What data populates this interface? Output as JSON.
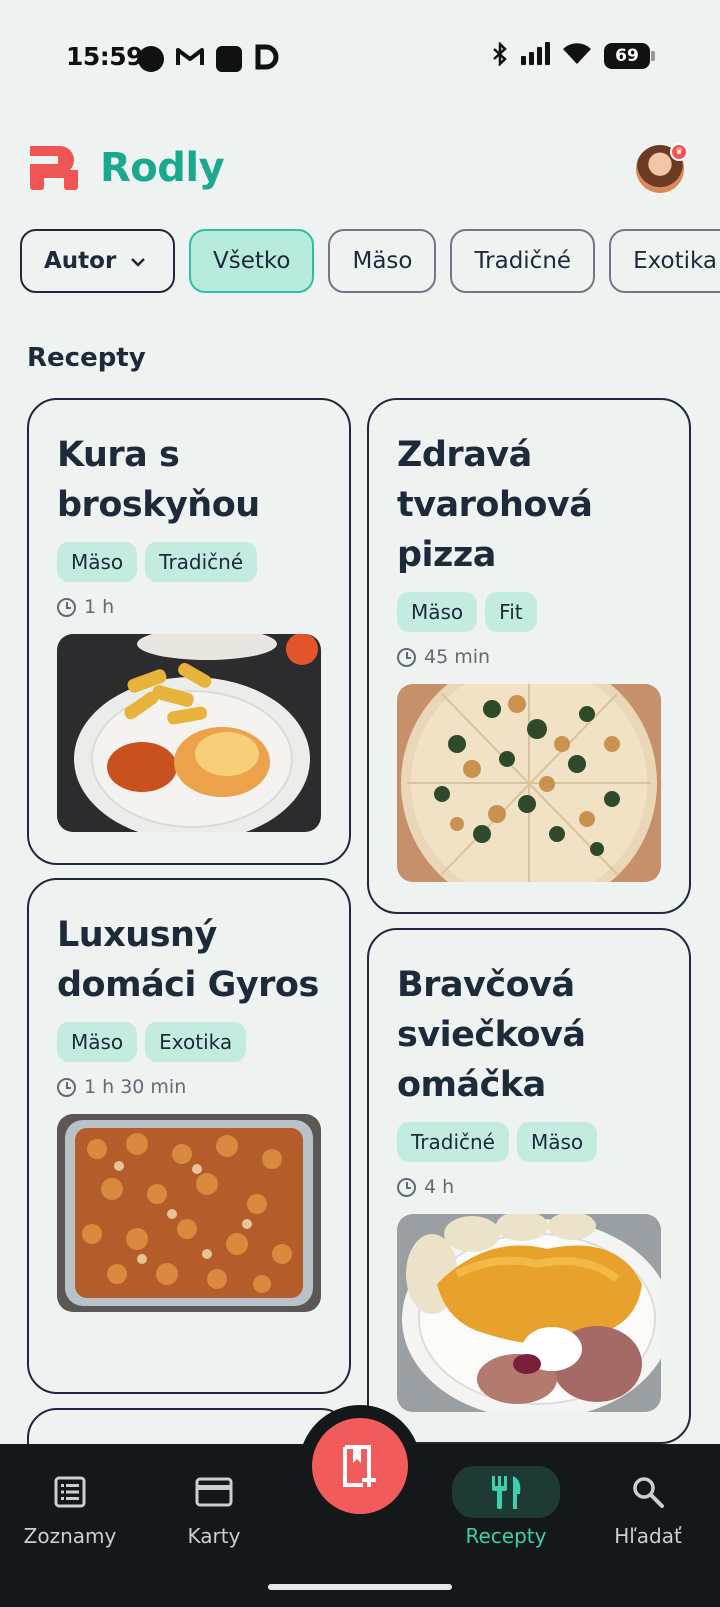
{
  "status_bar": {
    "time": "15:59",
    "left_icons": [
      "circle-icon",
      "gmail-icon",
      "square-icon",
      "d-app-icon"
    ],
    "right_icons": [
      "bluetooth-icon",
      "signal-icon",
      "wifi-icon"
    ],
    "battery": "69"
  },
  "header": {
    "app_name": "Rodly",
    "brand_color": "#f05556",
    "accent_color": "#1aa88e"
  },
  "filters": {
    "author_label": "Autor",
    "chips": [
      "Všetko",
      "Mäso",
      "Tradičné",
      "Exotika"
    ],
    "active": "Všetko"
  },
  "section": {
    "title": "Recepty"
  },
  "recipes": [
    {
      "title": "Kura s broskyňou",
      "tags": [
        "Mäso",
        "Tradičné"
      ],
      "time": "1 h"
    },
    {
      "title": "Zdravá tvarohová pizza",
      "tags": [
        "Mäso",
        "Fit"
      ],
      "time": "45 min"
    },
    {
      "title": "Luxusný domáci Gyros",
      "tags": [
        "Mäso",
        "Exotika"
      ],
      "time": "1 h 30 min"
    },
    {
      "title": "Bravčová sviečková omáčka",
      "tags": [
        "Tradičné",
        "Mäso"
      ],
      "time": "4 h"
    }
  ],
  "bottom_nav": {
    "items": [
      {
        "label": "Zoznamy",
        "icon": "list-icon"
      },
      {
        "label": "Karty",
        "icon": "card-icon"
      },
      {
        "label": "Recepty",
        "icon": "cutlery-icon"
      },
      {
        "label": "Hľadať",
        "icon": "search-icon"
      }
    ],
    "active": "Recepty",
    "fab_icon": "add-recipe-icon"
  }
}
